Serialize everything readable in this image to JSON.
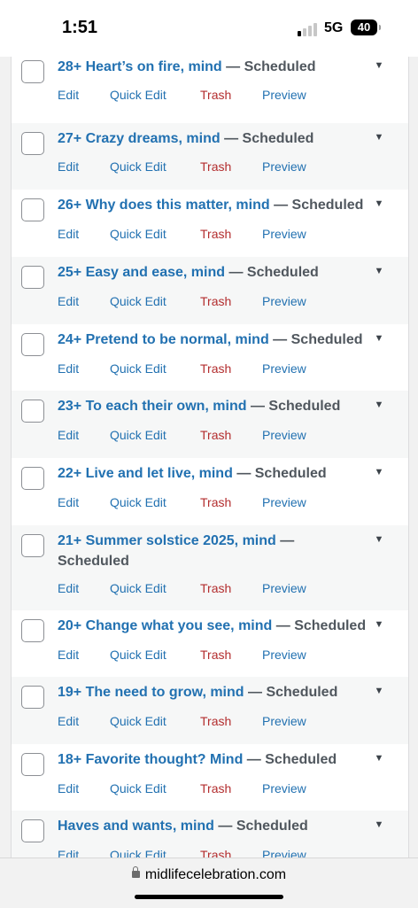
{
  "status": {
    "time": "1:51",
    "network": "5G",
    "battery": "40"
  },
  "colors": {
    "link": "#2271b1",
    "trash": "#b32d2e",
    "state": "#50575e",
    "row_alt": "#f6f7f7"
  },
  "actions": {
    "edit": "Edit",
    "quick_edit": "Quick Edit",
    "trash": "Trash",
    "preview": "Preview"
  },
  "posts": [
    {
      "title": "28+ Heart’s on fire, mind",
      "state": "— Scheduled"
    },
    {
      "title": "27+ Crazy dreams, mind",
      "state": "— Scheduled"
    },
    {
      "title": "26+ Why does this matter, mind",
      "state": "— Scheduled"
    },
    {
      "title": "25+ Easy and ease, mind",
      "state": "— Scheduled"
    },
    {
      "title": "24+ Pretend to be normal, mind",
      "state": "— Scheduled"
    },
    {
      "title": "23+ To each their own, mind",
      "state": "— Scheduled"
    },
    {
      "title": "22+ Live and let live, mind",
      "state": "— Scheduled"
    },
    {
      "title": "21+ Summer solstice 2025, mind",
      "state": "— Scheduled"
    },
    {
      "title": "20+ Change what you see, mind",
      "state": "— Scheduled"
    },
    {
      "title": "19+ The need to grow, mind",
      "state": "— Scheduled"
    },
    {
      "title": "18+ Favorite thought? Mind",
      "state": "— Scheduled"
    },
    {
      "title": "Haves and wants, mind",
      "state": "— Scheduled"
    }
  ],
  "browser": {
    "url": "midlifecelebration.com"
  }
}
